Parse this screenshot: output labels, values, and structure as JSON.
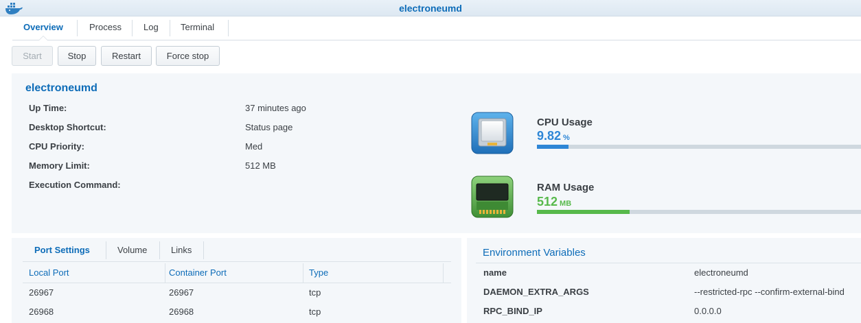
{
  "window": {
    "title": "electroneumd"
  },
  "tabs": [
    {
      "label": "Overview"
    },
    {
      "label": "Process"
    },
    {
      "label": "Log"
    },
    {
      "label": "Terminal"
    }
  ],
  "toolbar": {
    "start_label": "Start",
    "stop_label": "Stop",
    "restart_label": "Restart",
    "force_stop_label": "Force stop"
  },
  "overview": {
    "name": "electroneumd",
    "fields": [
      {
        "label": "Up Time:",
        "value": "37 minutes ago"
      },
      {
        "label": "Desktop Shortcut:",
        "value": "Status page"
      },
      {
        "label": "CPU Priority:",
        "value": "Med"
      },
      {
        "label": "Memory Limit:",
        "value": "512 MB"
      },
      {
        "label": "Execution Command:",
        "value": ""
      }
    ]
  },
  "cpu": {
    "title": "CPU Usage",
    "value": "9.82",
    "unit": "%",
    "fraction": 0.0982,
    "color": "#2e86d6",
    "icon": "cpu-chip-icon"
  },
  "ram": {
    "title": "RAM Usage",
    "value": "512",
    "unit": "MB",
    "fraction": 0.285,
    "color": "#57b94b",
    "icon": "ram-module-icon"
  },
  "ports": {
    "tabs": [
      {
        "label": "Port Settings"
      },
      {
        "label": "Volume"
      },
      {
        "label": "Links"
      }
    ],
    "columns": [
      "Local Port",
      "Container Port",
      "Type"
    ],
    "rows": [
      [
        "26967",
        "26967",
        "tcp"
      ],
      [
        "26968",
        "26968",
        "tcp"
      ]
    ]
  },
  "env": {
    "title": "Environment Variables",
    "vars": [
      {
        "name": "name",
        "value": "electroneumd"
      },
      {
        "name": "DAEMON_EXTRA_ARGS",
        "value": "--restricted-rpc --confirm-external-bind"
      },
      {
        "name": "RPC_BIND_IP",
        "value": "0.0.0.0"
      }
    ]
  },
  "colors": {
    "accent": "#0d6cb8",
    "panel_bg": "#f4f7fa"
  }
}
